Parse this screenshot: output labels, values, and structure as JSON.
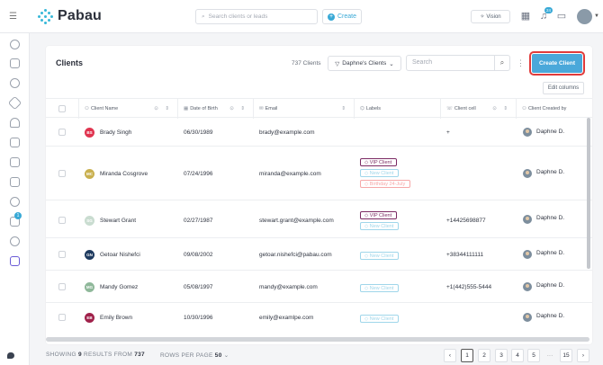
{
  "app": {
    "name": "Pabau"
  },
  "top": {
    "search_placeholder": "Search clients or leads",
    "create_label": "Create",
    "vision_label": "Vision",
    "notification_count": "24"
  },
  "page": {
    "title": "Clients",
    "count_label": "737 Clients",
    "filter_label": "Daphne's Clients",
    "search_placeholder": "Search",
    "create_button": "Create Client",
    "edit_columns": "Edit columns"
  },
  "columns": [
    "Client Name",
    "Date of Birth",
    "Email",
    "Labels",
    "Client cell",
    "Client Created by"
  ],
  "rows": [
    {
      "initials": "BS",
      "color": "#e0344f",
      "name": "Brady Singh",
      "dob": "06/30/1989",
      "email": "brady@example.com",
      "labels": [],
      "cell": "+",
      "creator": "Daphne D."
    },
    {
      "initials": "MC",
      "color": "#c9b04f",
      "name": "Miranda Cosgrove",
      "dob": "07/24/1996",
      "email": "miranda@example.com",
      "labels": [
        {
          "type": "vip",
          "text": "VIP Client"
        },
        {
          "type": "new",
          "text": "New Client"
        },
        {
          "type": "bday",
          "text": "Birthday 24-July"
        }
      ],
      "cell": "",
      "creator": "Daphne D."
    },
    {
      "initials": "SG",
      "color": "#c9dcd0",
      "name": "Stewart Grant",
      "dob": "02/27/1987",
      "email": "stewart.grant@example.com",
      "labels": [
        {
          "type": "vip",
          "text": "VIP Client"
        },
        {
          "type": "new",
          "text": "New Client"
        }
      ],
      "cell": "+14425698877",
      "creator": "Daphne D."
    },
    {
      "initials": "GN",
      "color": "#1e3a5f",
      "name": "Getoar Nishefci",
      "dob": "09/08/2002",
      "email": "getoar.nishefci@pabau.com",
      "labels": [
        {
          "type": "new",
          "text": "New Client"
        }
      ],
      "cell": "+38344111111",
      "creator": "Daphne D."
    },
    {
      "initials": "MG",
      "color": "#8fb89a",
      "name": "Mandy Gomez",
      "dob": "05/08/1997",
      "email": "mandy@example.com",
      "labels": [
        {
          "type": "new",
          "text": "New Client"
        }
      ],
      "cell": "+1(442)555-5444",
      "creator": "Daphne D."
    },
    {
      "initials": "EB",
      "color": "#a0224b",
      "name": "Emily Brown",
      "dob": "10/30/1996",
      "email": "emily@examlpe.com",
      "labels": [
        {
          "type": "new",
          "text": "New Client"
        }
      ],
      "cell": "",
      "creator": "Daphne D."
    }
  ],
  "footer": {
    "showing_prefix": "SHOWING",
    "showing_count": "9",
    "results_from": "RESULTS FROM",
    "total": "737",
    "rows_per_page_label": "ROWS PER PAGE",
    "rows_per_page": "50"
  },
  "pagination": [
    "1",
    "2",
    "3",
    "4",
    "5",
    "···",
    "15"
  ]
}
